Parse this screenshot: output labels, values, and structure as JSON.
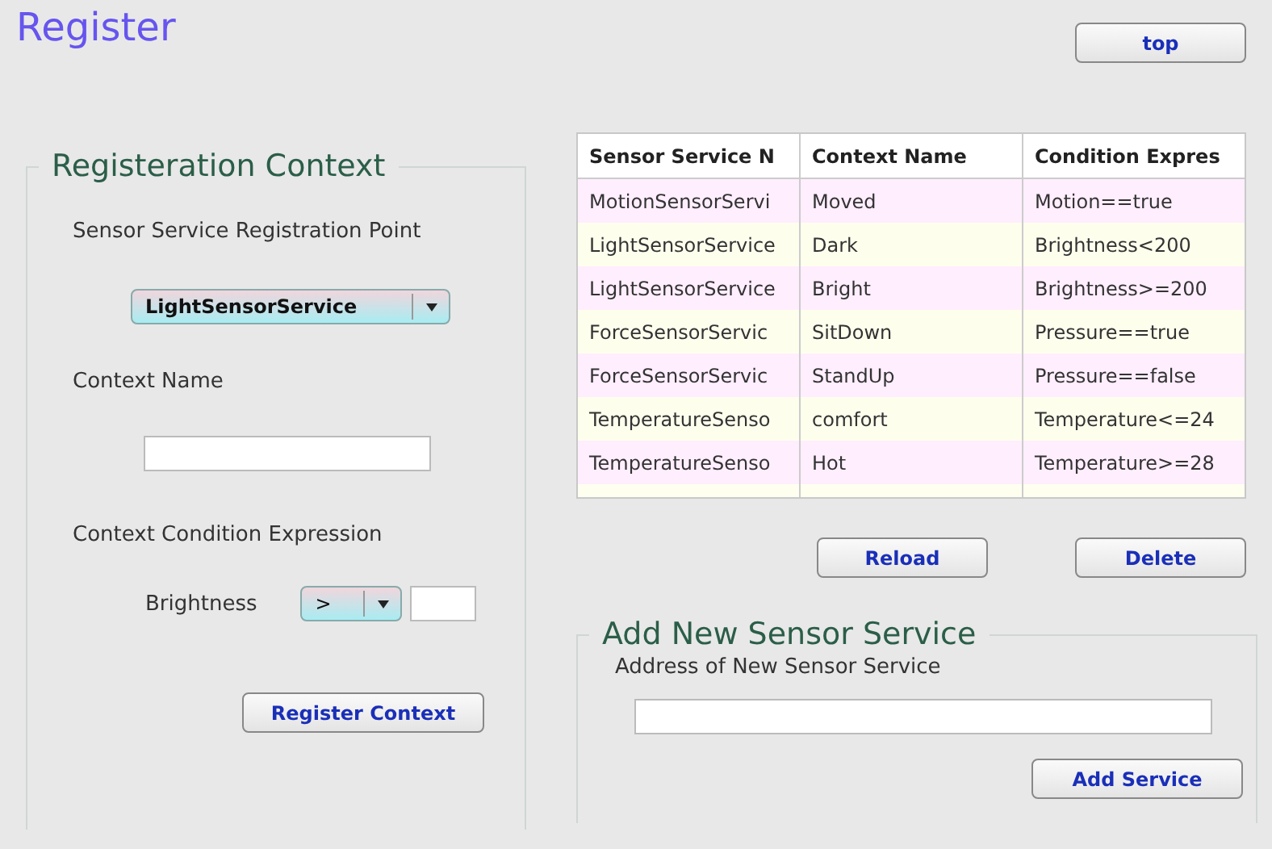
{
  "title": "Register",
  "top_button": "top",
  "registration_context": {
    "title": "Registeration Context",
    "service_label": "Sensor Service Registration Point",
    "service_select": {
      "value": "LightSensorService"
    },
    "context_name_label": "Context Name",
    "condition_label": "Context Condition Expression",
    "condition": {
      "variable": "Brightness",
      "operator": ">"
    },
    "register_button": "Register Context"
  },
  "table": {
    "columns": [
      "Sensor Service N",
      "Context Name",
      "Condition Expres"
    ],
    "rows": [
      [
        "MotionSensorServi",
        "Moved",
        "Motion==true"
      ],
      [
        "LightSensorService",
        "Dark",
        "Brightness<200"
      ],
      [
        "LightSensorService",
        "Bright",
        "Brightness>=200"
      ],
      [
        "ForceSensorServic",
        "SitDown",
        "Pressure==true"
      ],
      [
        "ForceSensorServic",
        "StandUp",
        "Pressure==false"
      ],
      [
        "TemperatureSenso",
        "comfort",
        "Temperature<=24"
      ],
      [
        "TemperatureSenso",
        "Hot",
        "Temperature>=28"
      ]
    ]
  },
  "table_buttons": [
    "Reload",
    "Delete"
  ],
  "add_service": {
    "title": "Add New Sensor Service",
    "address_label": "Address of New Sensor Service",
    "add_button": "Add Service"
  }
}
